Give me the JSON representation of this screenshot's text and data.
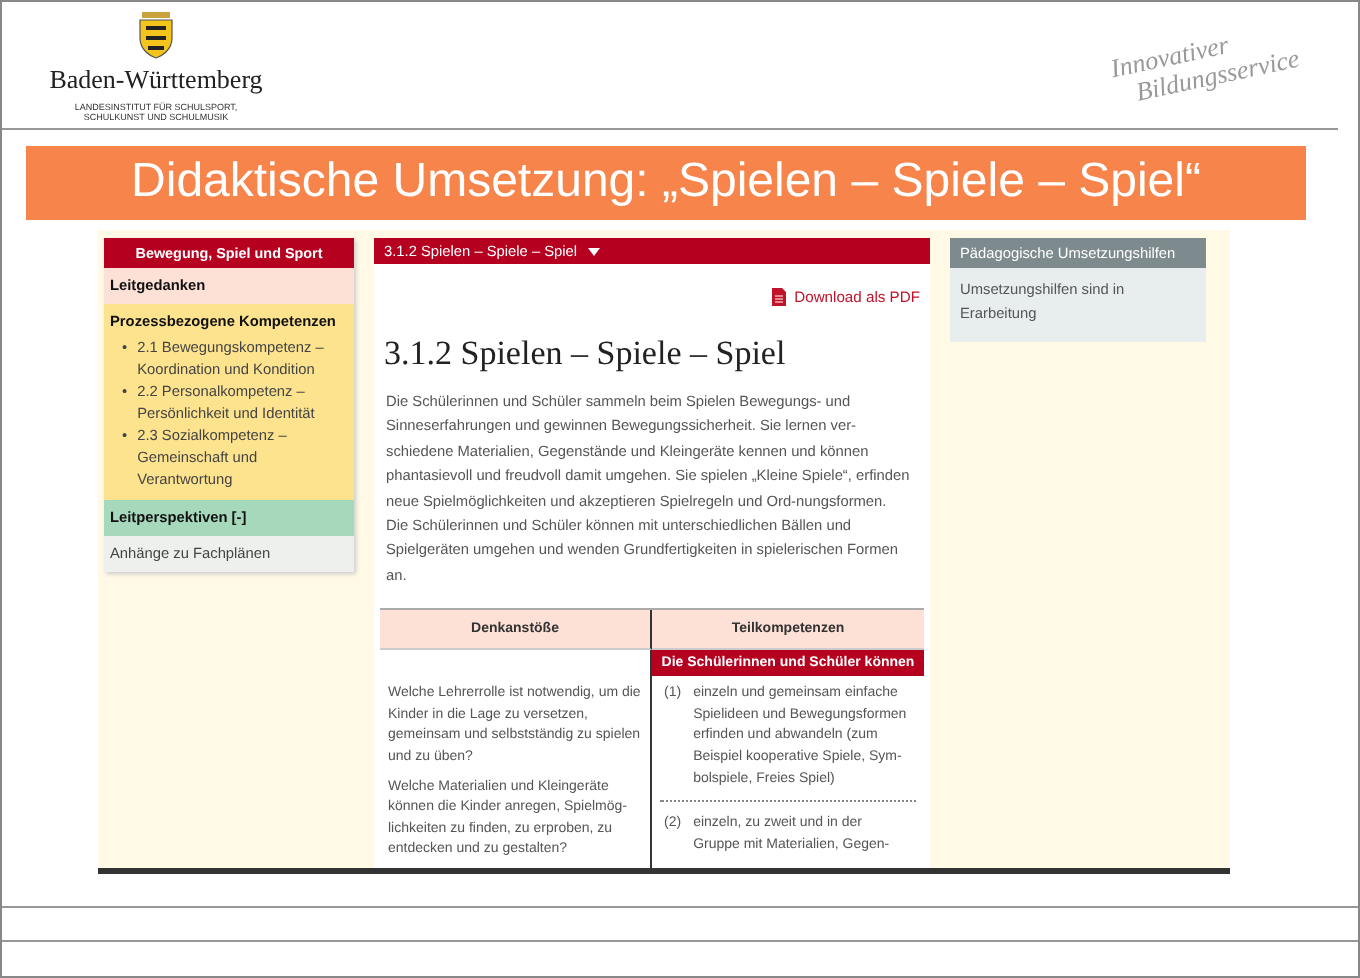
{
  "header": {
    "brand": "Baden-Württemberg",
    "institute": [
      "LANDESINSTITUT FÜR SCHULSPORT,",
      "SCHULKUNST UND SCHULMUSIK"
    ],
    "tagline": [
      "Innovativer",
      "Bildungsservice"
    ]
  },
  "title": "Didaktische Umsetzung: „Spielen – Spiele – Spiel“",
  "screenshot": {
    "sidebar": {
      "heading": "Bewegung, Spiel und Sport",
      "sections": [
        {
          "kind": "plain",
          "title": "Leitgedanken"
        },
        {
          "kind": "list",
          "title": "Prozessbezogene Kompetenzen",
          "items": [
            {
              "bullet": "•",
              "text": "2.1 Bewegungskompetenz – Koordination und Kondition"
            },
            {
              "bullet": "•",
              "text": "2.2 Personalkompetenz – Persönlichkeit und Identität"
            },
            {
              "bullet": "•",
              "text": "2.3 Sozialkompetenz – Gemeinschaft und Verantwortung"
            }
          ]
        },
        {
          "kind": "toggle",
          "title": "Leitperspektiven [-]"
        },
        {
          "kind": "link",
          "title": "Anhänge zu Fachplänen"
        }
      ]
    },
    "breadcrumb": "3.1.2 Spielen – Spiele – Spiel",
    "download": "Download als PDF",
    "heading": "3.1.2 Spielen – Spiele – Spiel",
    "paragraphs": [
      "Die Schülerinnen und Schüler sammeln beim Spielen Bewegungs- und Sinneserfahrungen und gewinnen Bewegungssicherheit. Sie lernen ver-schiedene Materialien, Gegenstände und Kleingeräte kennen und können phantasievoll und freudvoll damit umgehen. Sie spielen „Kleine Spiele“, erfinden neue Spielmöglichkeiten und akzeptieren Spielregeln und Ord-nungsformen.",
      "Die Schülerinnen und Schüler können mit unterschiedlichen Bällen und Spielgeräten umgehen und wenden Grundfertigkeiten in spielerischen Formen an."
    ],
    "table": {
      "columns": [
        "Denkanstöße",
        "Teilkompetenzen"
      ],
      "subheading": "Die Schülerinnen und Schüler können",
      "questions": [
        "Welche Lehrerrolle ist notwendig, um die Kinder in die Lage zu versetzen, gemeinsam und selbstständig zu spielen und zu üben?",
        "Welche Materialien und Kleingeräte können die Kinder anregen, Spielmög-lichkeiten zu finden, zu erproben, zu entdecken und zu gestalten?"
      ],
      "competences": [
        {
          "number": "(1)",
          "text": "einzeln und gemeinsam einfache Spielideen und Bewegungsformen erfinden und abwandeln (zum Beispiel kooperative Spiele, Sym-bolspiele, Freies Spiel)"
        },
        {
          "number": "(2)",
          "text": "einzeln, zu zweit und in der Gruppe mit Materialien, Gegen-"
        }
      ]
    },
    "aside": {
      "heading": "Pädagogische Umsetzungshilfen",
      "text": "Umsetzungshilfen sind in Erarbeitung"
    }
  }
}
